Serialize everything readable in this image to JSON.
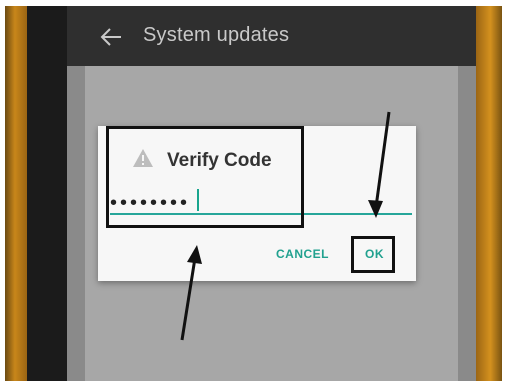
{
  "appbar": {
    "title": "System updates",
    "back_icon": "arrow-left-icon"
  },
  "dialog": {
    "icon": "warning-icon",
    "title": "Verify Code",
    "input_value": "••••••••",
    "cancel_label": "CANCEL",
    "ok_label": "OK"
  },
  "colors": {
    "accent": "#26a69a",
    "dialog_bg": "#f7f7f7",
    "appbar_bg": "#2f2f2f",
    "device_bezel": "#c8861a"
  }
}
